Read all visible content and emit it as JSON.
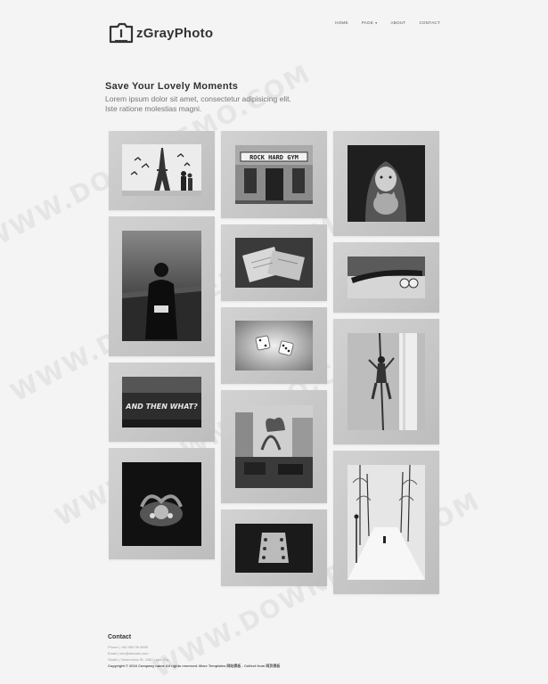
{
  "brand": {
    "name": "zGrayPhoto"
  },
  "nav": {
    "items": [
      {
        "label": "HOME",
        "has_dropdown": false
      },
      {
        "label": "PAGE",
        "has_dropdown": true
      },
      {
        "label": "ABOUT",
        "has_dropdown": false
      },
      {
        "label": "CONTACT",
        "has_dropdown": false
      }
    ]
  },
  "intro": {
    "heading": "Save Your Lovely Moments",
    "text_line1": "Lorem ipsum dolor sit amet, consectetur adipisicing elit.",
    "text_line2": "Iste ratione molestias magni."
  },
  "gallery": {
    "photos": [
      {
        "name": "eiffel-tower-photo",
        "subject": "eiffel tower with birds"
      },
      {
        "name": "rock-hard-gym-photo",
        "subject": "storefront",
        "sign_text": "ROCK HARD GYM"
      },
      {
        "name": "girl-with-cat-photo",
        "subject": "girl holding a cat"
      },
      {
        "name": "man-on-pier-photo",
        "subject": "man on a pier"
      },
      {
        "name": "papers-on-desk-photo",
        "subject": "papers on a desk"
      },
      {
        "name": "skateboard-photo",
        "subject": "skateboard"
      },
      {
        "name": "dice-photo",
        "subject": "two dice"
      },
      {
        "name": "pole-climber-photo",
        "subject": "man climbing a pole"
      },
      {
        "name": "graffiti-photo",
        "subject": "wall graffiti",
        "graffiti_text": "AND THEN WHAT?"
      },
      {
        "name": "paris-street-photo",
        "subject": "paris street"
      },
      {
        "name": "hands-photo",
        "subject": "hands holding"
      },
      {
        "name": "snowy-park-photo",
        "subject": "snowy park path"
      },
      {
        "name": "guitar-photo",
        "subject": "guitar headstock"
      }
    ]
  },
  "footer": {
    "heading": "Contact",
    "phone": "Phone | +80 999 99 9999",
    "email": "Email | info@domain.com",
    "studio": "Studio | Yesnoroma St. 1060 Light City",
    "copyright": "Copyright © 2016 Company name All rights reserved. More Templates 网站模板 - Collect from 网页模板"
  },
  "watermark": {
    "text": "WWW.DOWNDEMO.COM"
  },
  "colors": {
    "background": "#f4f4f4",
    "card": "#c8c8c8",
    "text": "#333333"
  }
}
